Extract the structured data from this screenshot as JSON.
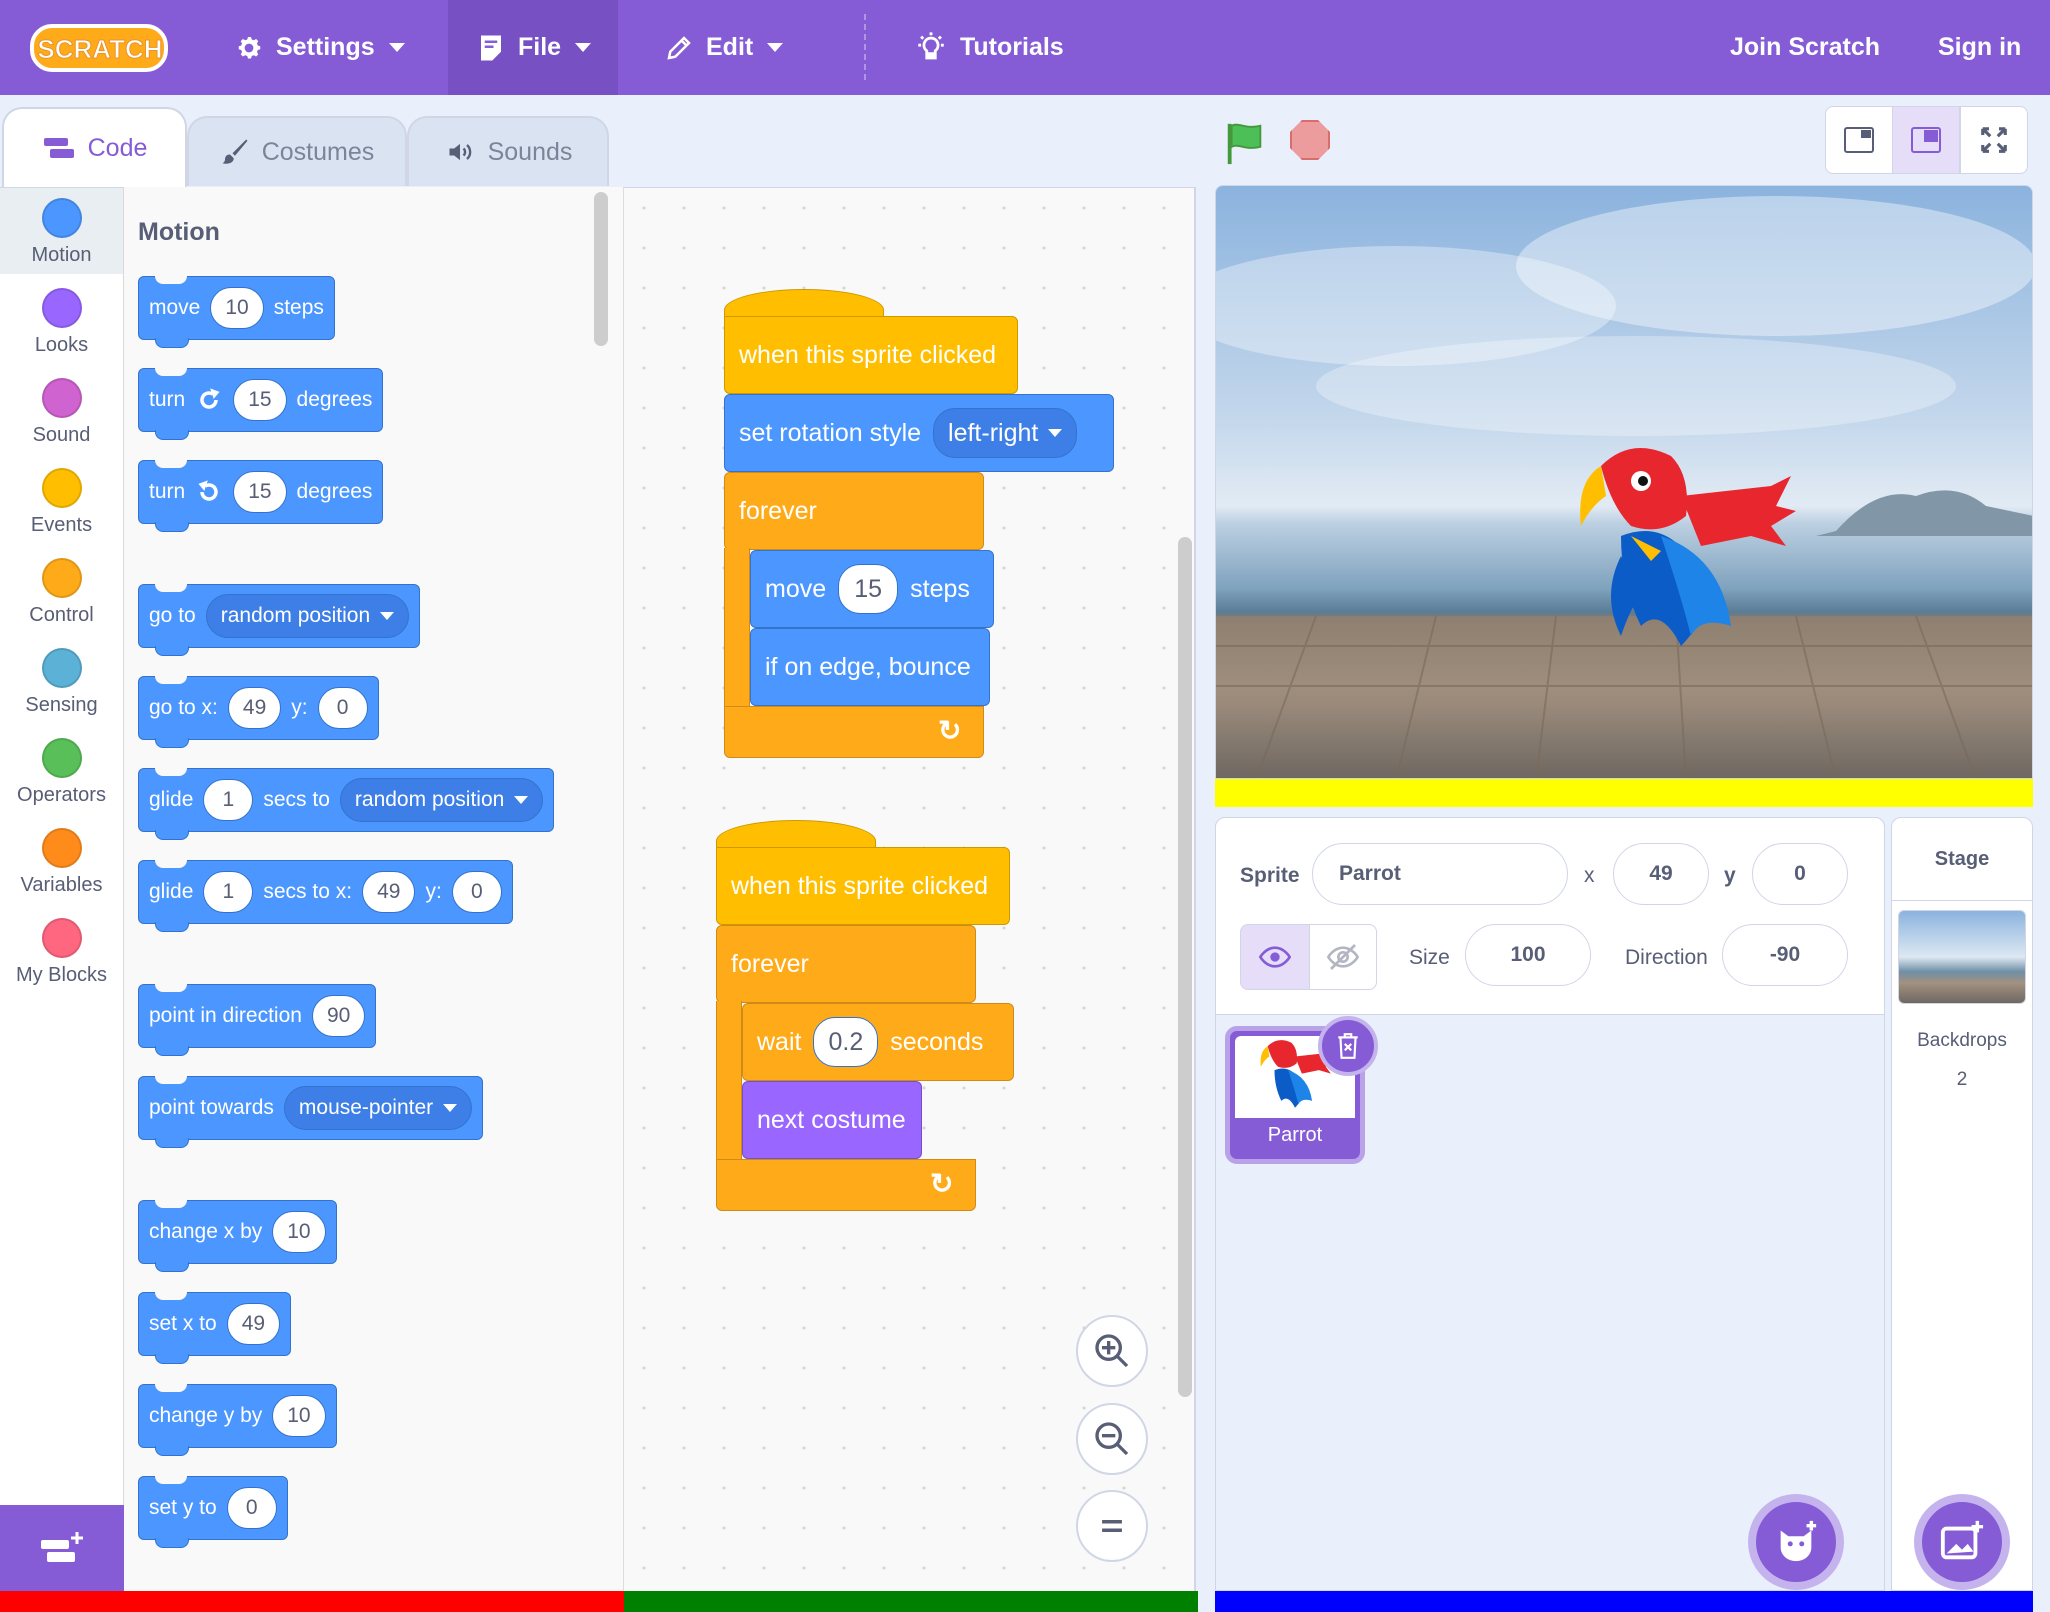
{
  "menubar": {
    "logo_text": "SCRATCH",
    "settings": "Settings",
    "file": "File",
    "edit": "Edit",
    "tutorials": "Tutorials",
    "join": "Join Scratch",
    "sign_in": "Sign in",
    "colors": {
      "bar": "#855cd6",
      "active": "#7751c3"
    }
  },
  "tabs": {
    "code": "Code",
    "costumes": "Costumes",
    "sounds": "Sounds",
    "selected": "Code"
  },
  "categories": [
    {
      "label": "Motion",
      "color": "#4c97ff"
    },
    {
      "label": "Looks",
      "color": "#9966ff"
    },
    {
      "label": "Sound",
      "color": "#cf63cf"
    },
    {
      "label": "Events",
      "color": "#ffbf00"
    },
    {
      "label": "Control",
      "color": "#ffab19"
    },
    {
      "label": "Sensing",
      "color": "#5cb1d6"
    },
    {
      "label": "Operators",
      "color": "#59c059"
    },
    {
      "label": "Variables",
      "color": "#ff8c1a"
    },
    {
      "label": "My Blocks",
      "color": "#ff6680"
    }
  ],
  "flyout": {
    "title": "Motion",
    "move": {
      "a": "move",
      "v": "10",
      "b": "steps"
    },
    "turn_right": {
      "a": "turn",
      "v": "15",
      "b": "degrees"
    },
    "turn_left": {
      "a": "turn",
      "v": "15",
      "b": "degrees"
    },
    "goto": {
      "a": "go to",
      "menu": "random position"
    },
    "gotoxy": {
      "a": "go to x:",
      "x": "49",
      "b": "y:",
      "y": "0"
    },
    "glide_to": {
      "a": "glide",
      "v": "1",
      "b": "secs to",
      "menu": "random position"
    },
    "glide_xy": {
      "a": "glide",
      "v": "1",
      "b": "secs to x:",
      "x": "49",
      "c": "y:",
      "y": "0"
    },
    "point_dir": {
      "a": "point in direction",
      "v": "90"
    },
    "point_towards": {
      "a": "point towards",
      "menu": "mouse-pointer"
    },
    "change_x": {
      "a": "change x by",
      "v": "10"
    },
    "set_x": {
      "a": "set x to",
      "v": "49"
    },
    "change_y": {
      "a": "change y by",
      "v": "10"
    },
    "set_y": {
      "a": "set y to",
      "v": "0"
    }
  },
  "script1": {
    "hat": "when this sprite clicked",
    "rotation": {
      "a": "set rotation style",
      "menu": "left-right"
    },
    "forever": "forever",
    "move": {
      "a": "move",
      "v": "15",
      "b": "steps"
    },
    "bounce": "if on edge, bounce"
  },
  "script2": {
    "hat": "when this sprite clicked",
    "forever": "forever",
    "wait": {
      "a": "wait",
      "v": "0.2",
      "b": "seconds"
    },
    "next_costume": "next costume"
  },
  "sprite_info": {
    "sprite_label": "Sprite",
    "name": "Parrot",
    "x_label": "x",
    "x": "49",
    "y_label": "y",
    "y": "0",
    "size_label": "Size",
    "size": "100",
    "direction_label": "Direction",
    "direction": "-90"
  },
  "sprites": [
    {
      "name": "Parrot",
      "selected": true
    }
  ],
  "stage_pane": {
    "title": "Stage",
    "backdrops_label": "Backdrops",
    "backdrops_count": "2"
  },
  "bars": {
    "palette": "#ff0000",
    "workspace": "#008000",
    "stage": "#0000ff",
    "stage_bottom": "#ffff00"
  }
}
